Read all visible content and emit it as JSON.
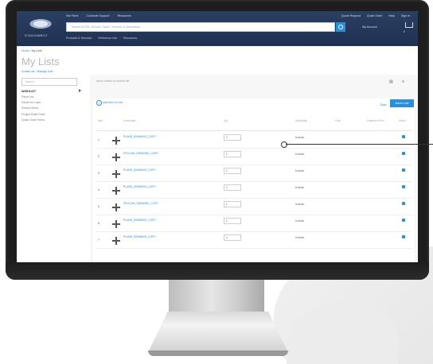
{
  "header": {
    "logo_text": "STADIUMBOT",
    "top_links": [
      "Sell Parts",
      "Customer Support",
      "Resources"
    ],
    "search_placeholder": "Search for P/N, Vendors, Specs, Products or descriptions",
    "right_links": [
      "Quote Request",
      "Quick Order",
      "Help",
      "Sign In"
    ],
    "account": "My Account",
    "cart_count": "0",
    "subnav": [
      "Products & Services",
      "Reference Info",
      "Resources"
    ]
  },
  "breadcrumb": {
    "home": "Home",
    "current": "My Lists"
  },
  "sidebar": {
    "title": "My Lists",
    "links": "Create List · Manage Lists",
    "search_placeholder": "Search",
    "heading": "WISHLIST",
    "items": [
      "Parts List",
      "Saved for Later",
      "Recent Items",
      "Project Build Parts",
      "Quick Order Items"
    ]
  },
  "main": {
    "top_label": "Items added to current list",
    "top_icons": "▤ ≡",
    "add_item": "Add Item to List",
    "clear": "Clear",
    "add_to_cart": "Add to Cart",
    "columns": [
      "Item",
      "Description",
      "Qty",
      "Availability",
      "Price",
      "Extended Price",
      "Select"
    ]
  },
  "rows": [
    {
      "num": "1",
      "link": "PLANE_DRAWING_COPY",
      "qty": "1",
      "avail": "In stock"
    },
    {
      "num": "2",
      "link": "PELICAN_DRAWING_COPY",
      "qty": "1",
      "avail": "In stock"
    },
    {
      "num": "3",
      "link": "PLANE_DRAWING_COPY",
      "qty": "1",
      "avail": "In stock"
    },
    {
      "num": "4",
      "link": "PLANE_DRAWING_COPY",
      "qty": "1",
      "avail": "In stock"
    },
    {
      "num": "5",
      "link": "PELICAN_DRAWING_COPY",
      "qty": "1",
      "avail": "In stock"
    },
    {
      "num": "6",
      "link": "PLANE_DRAWING_COPY",
      "qty": "1",
      "avail": "In stock"
    },
    {
      "num": "7",
      "link": "PLANE_DRAWING_COPY",
      "qty": "1",
      "avail": "In stock"
    }
  ]
}
